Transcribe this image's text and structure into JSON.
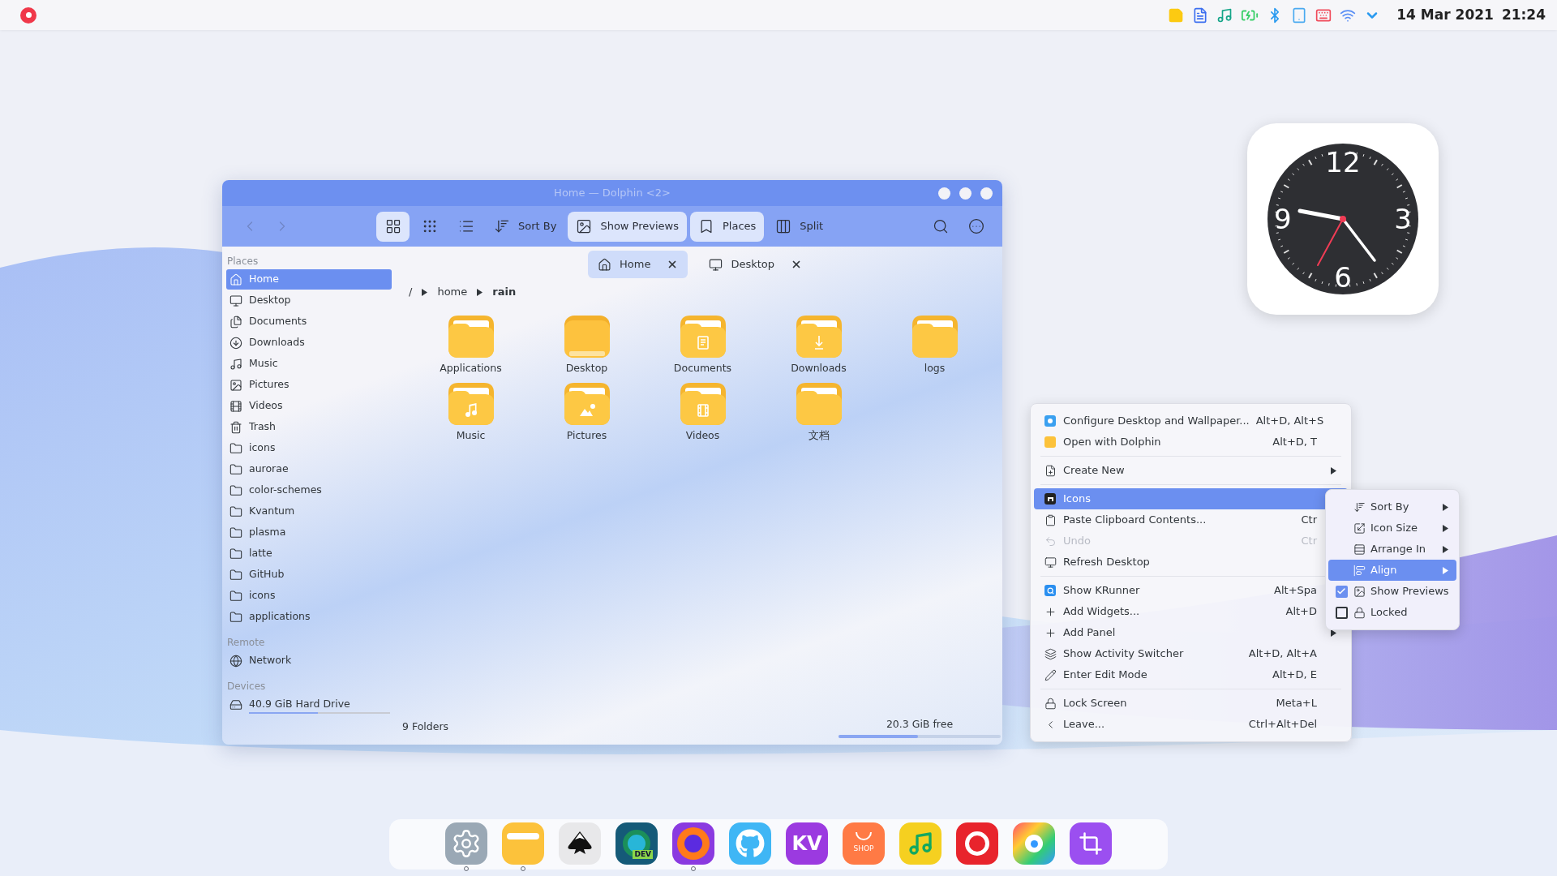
{
  "top_bar": {
    "date": "14 Mar 2021",
    "time": "21:24"
  },
  "dolphin": {
    "title": "Home — Dolphin <2>",
    "nav": [
      {
        "kind": "back",
        "disabled": true
      },
      {
        "kind": "forward",
        "disabled": true
      }
    ],
    "view_modes": [
      {
        "kind": "icons",
        "selected": true
      },
      {
        "kind": "compact",
        "selected": false
      },
      {
        "kind": "details",
        "selected": false
      }
    ],
    "actions": [
      {
        "kind": "sort",
        "label": "Sort By",
        "selected": false
      },
      {
        "kind": "previews",
        "label": "Show Previews",
        "selected": true
      },
      {
        "kind": "places",
        "label": "Places",
        "selected": true
      },
      {
        "kind": "split",
        "label": "Split",
        "selected": false
      }
    ],
    "tools": [
      {
        "kind": "search"
      },
      {
        "kind": "menu"
      }
    ],
    "tabs": [
      {
        "label": "Home",
        "kind": "home",
        "selected": true
      },
      {
        "label": "Desktop",
        "kind": "desktop",
        "selected": false
      }
    ],
    "breadcrumb": [
      "/",
      "home",
      "rain"
    ],
    "sidebar": [
      {
        "heading": "Places",
        "items": [
          {
            "label": "Home",
            "kind": "home",
            "selected": true
          },
          {
            "label": "Desktop",
            "kind": "desktop",
            "selected": false
          },
          {
            "label": "Documents",
            "kind": "documents",
            "selected": false
          },
          {
            "label": "Downloads",
            "kind": "downloads",
            "selected": false
          },
          {
            "label": "Music",
            "kind": "music",
            "selected": false
          },
          {
            "label": "Pictures",
            "kind": "pictures",
            "selected": false
          },
          {
            "label": "Videos",
            "kind": "videos",
            "selected": false
          },
          {
            "label": "Trash",
            "kind": "trash",
            "selected": false
          },
          {
            "label": "icons",
            "kind": "folder",
            "selected": false
          },
          {
            "label": "aurorae",
            "kind": "folder",
            "selected": false
          },
          {
            "label": "color-schemes",
            "kind": "folder",
            "selected": false
          },
          {
            "label": "Kvantum",
            "kind": "folder",
            "selected": false
          },
          {
            "label": "plasma",
            "kind": "folder",
            "selected": false
          },
          {
            "label": "latte",
            "kind": "folder",
            "selected": false
          },
          {
            "label": "GitHub",
            "kind": "folder",
            "selected": false
          },
          {
            "label": "icons",
            "kind": "folder",
            "selected": false
          },
          {
            "label": "applications",
            "kind": "folder",
            "selected": false
          }
        ]
      },
      {
        "heading": "Remote",
        "items": [
          {
            "label": "Network",
            "kind": "network",
            "selected": false
          }
        ]
      },
      {
        "heading": "Devices",
        "items": [
          {
            "label": "40.9 GiB Hard Drive",
            "kind": "drive",
            "selected": false,
            "level": 0.49
          }
        ]
      }
    ],
    "files": [
      {
        "name": "Applications",
        "kind": "plain"
      },
      {
        "name": "Desktop",
        "kind": "desktop"
      },
      {
        "name": "Documents",
        "kind": "documents"
      },
      {
        "name": "Downloads",
        "kind": "downloads"
      },
      {
        "name": "logs",
        "kind": "plain"
      },
      {
        "name": "Music",
        "kind": "music"
      },
      {
        "name": "Pictures",
        "kind": "pictures"
      },
      {
        "name": "Videos",
        "kind": "videos"
      },
      {
        "name": "文档",
        "kind": "plain"
      }
    ],
    "status": {
      "count": "9 Folders",
      "free": "20.3 GiB free",
      "level": 0.49
    }
  },
  "clock": {
    "numerals": [
      "12",
      "3",
      "6",
      "9"
    ]
  },
  "context_menu": {
    "groups": [
      [
        {
          "label": "Configure Desktop and Wallpaper...",
          "shortcut": "Alt+D, Alt+S",
          "kind": "configure",
          "selected": false,
          "disabled": false
        },
        {
          "label": "Open with Dolphin",
          "shortcut": "Alt+D, T",
          "kind": "dolphin",
          "selected": false,
          "disabled": false
        }
      ],
      [
        {
          "label": "Create New",
          "kind": "create",
          "selected": false,
          "disabled": false,
          "has_submenu": true
        }
      ],
      [
        {
          "label": "Icons",
          "kind": "icons",
          "selected": true,
          "disabled": false
        },
        {
          "label": "Paste Clipboard Contents...",
          "shortcut": "Ctr",
          "kind": "paste",
          "selected": false,
          "disabled": false
        },
        {
          "label": "Undo",
          "shortcut": "Ctr",
          "kind": "undo",
          "selected": false,
          "disabled": true
        },
        {
          "label": "Refresh Desktop",
          "kind": "refresh",
          "selected": false,
          "disabled": false
        }
      ],
      [
        {
          "label": "Show KRunner",
          "shortcut": "Alt+Spa",
          "kind": "krunner",
          "selected": false,
          "disabled": false
        },
        {
          "label": "Add Widgets...",
          "shortcut": "Alt+D",
          "kind": "add",
          "selected": false,
          "disabled": false
        },
        {
          "label": "Add Panel",
          "kind": "add",
          "selected": false,
          "disabled": false,
          "has_submenu": true
        },
        {
          "label": "Show Activity Switcher",
          "shortcut": "Alt+D, Alt+A",
          "kind": "activity",
          "selected": false,
          "disabled": false
        },
        {
          "label": "Enter Edit Mode",
          "shortcut": "Alt+D, E",
          "kind": "edit",
          "selected": false,
          "disabled": false
        }
      ],
      [
        {
          "label": "Lock Screen",
          "shortcut": "Meta+L",
          "kind": "lock",
          "selected": false,
          "disabled": false
        },
        {
          "label": "Leave...",
          "shortcut": "Ctrl+Alt+Del",
          "kind": "leave",
          "selected": false,
          "disabled": false
        }
      ]
    ]
  },
  "submenu": [
    {
      "label": "Sort By",
      "kind": "sort",
      "selected": false,
      "has_submenu": true
    },
    {
      "label": "Icon Size",
      "kind": "size",
      "selected": false,
      "has_submenu": true
    },
    {
      "label": "Arrange In",
      "kind": "arrange",
      "selected": false,
      "has_submenu": true
    },
    {
      "label": "Align",
      "kind": "align",
      "selected": true,
      "has_submenu": true
    },
    {
      "label": "Show Previews",
      "kind": "previews",
      "selected": false,
      "has_submenu": false,
      "check": {
        "checked": true
      }
    },
    {
      "label": "Locked",
      "kind": "lock",
      "selected": false,
      "has_submenu": false,
      "check": {
        "checked": false
      }
    }
  ],
  "dock": [
    {
      "kind": "settings",
      "running": true
    },
    {
      "kind": "files",
      "running": true
    },
    {
      "kind": "inkscape",
      "running": false
    },
    {
      "kind": "edge",
      "label": "DEV",
      "running": false
    },
    {
      "kind": "firefox",
      "running": true
    },
    {
      "kind": "github",
      "running": false
    },
    {
      "kind": "kv",
      "label": "KV",
      "running": false
    },
    {
      "kind": "shop",
      "label": "SHOP",
      "running": false
    },
    {
      "kind": "music",
      "running": false
    },
    {
      "kind": "netease",
      "running": false
    },
    {
      "kind": "photos",
      "running": false
    },
    {
      "kind": "crop",
      "running": false
    }
  ]
}
